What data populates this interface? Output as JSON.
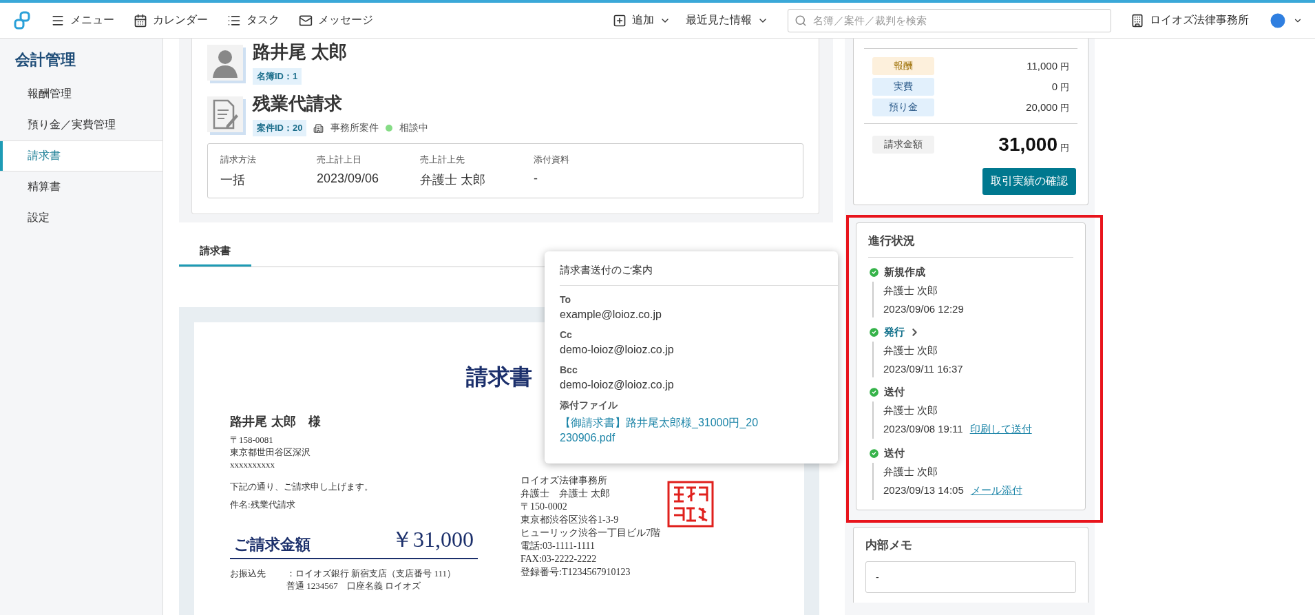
{
  "topbar": {
    "nav": [
      {
        "kind": "menu",
        "label": "メニュー"
      },
      {
        "kind": "calendar",
        "label": "カレンダー"
      },
      {
        "kind": "task",
        "label": "タスク"
      },
      {
        "kind": "message",
        "label": "メッセージ"
      }
    ],
    "add": "追加",
    "recent": "最近見た情報",
    "search": {
      "placeholder": "名簿／案件／裁判を検索"
    },
    "office": "ロイオズ法律事務所"
  },
  "sidebar": {
    "title": "会計管理",
    "items": [
      {
        "label": "報酬管理",
        "selected": false
      },
      {
        "label": "預り金／実費管理",
        "selected": false
      },
      {
        "label": "請求書",
        "selected": true
      },
      {
        "label": "精算書",
        "selected": false
      },
      {
        "label": "設定",
        "selected": false
      }
    ]
  },
  "header": {
    "client_name": "路井尾 太郎",
    "client_id": "名簿ID：1",
    "case_title": "残業代請求",
    "case_id": "案件ID：20",
    "case_type": "事務所案件",
    "status": {
      "label": "相談中",
      "color": "#86dc86"
    },
    "fields": [
      {
        "label": "請求方法",
        "value": "一括"
      },
      {
        "label": "売上計上日",
        "value": "2023/09/06"
      },
      {
        "label": "売上計上先",
        "value": "弁護士 太郎"
      },
      {
        "label": "添付資料",
        "value": "-"
      }
    ]
  },
  "tabs": [
    {
      "label": "請求書",
      "selected": true
    }
  ],
  "invoice": {
    "title": "請求書",
    "recipient": "路井尾 太郎　様",
    "address": [
      "〒158-0081",
      "東京都世田谷区深沢",
      "xxxxxxxxxx"
    ],
    "intro": "下記の通り、ご請求申し上げます。",
    "subject": "件名:残業代請求",
    "amount_label": "ご請求金額",
    "amount": "￥31,000",
    "bank_label": "お振込先",
    "bank_lines": [
      "：ロイオズ銀行 新宿支店（支店番号 111）",
      "普通 1234567　口座名義 ロイオズ"
    ],
    "issuer": [
      "ロイオズ法律事務所",
      "弁護士　弁護士 太郎",
      "〒150-0002",
      "東京都渋谷区渋谷1-3-9",
      "ヒューリック渋谷一丁目ビル7階",
      "電話:03-1111-1111",
      "FAX:03-2222-2222",
      "登録番号:T1234567910123"
    ]
  },
  "email_popup": {
    "title": "請求書送付のご案内",
    "fields": [
      {
        "label": "To",
        "value": "example@loioz.co.jp"
      },
      {
        "label": "Cc",
        "value": "demo-loioz@loioz.co.jp"
      },
      {
        "label": "Bcc",
        "value": "demo-loioz@loioz.co.jp"
      }
    ],
    "attachment": {
      "label": "添付ファイル",
      "file": "【御請求書】路井尾太郎様_31000円_20230906.pdf"
    }
  },
  "summary": {
    "rows": [
      {
        "kind": "fee",
        "label": "報酬",
        "amount": "11,000",
        "unit": "円"
      },
      {
        "kind": "expense",
        "label": "実費",
        "amount": "0",
        "unit": "円"
      },
      {
        "kind": "deposit",
        "label": "預り金",
        "amount": "20,000",
        "unit": "円"
      }
    ],
    "total": {
      "label": "請求金額",
      "amount": "31,000",
      "unit": "円"
    },
    "button": "取引実績の確認"
  },
  "progress": {
    "title": "進行状況",
    "highlighted": true,
    "steps": [
      {
        "kind": "plain",
        "title": "新規作成",
        "person": "弁護士 次郎",
        "time": "2023/09/06 12:29"
      },
      {
        "kind": "link",
        "title": "発行",
        "person": "弁護士 次郎",
        "time": "2023/09/11 16:37"
      },
      {
        "kind": "plain",
        "title": "送付",
        "person": "弁護士 次郎",
        "time": "2023/09/08 19:11",
        "action": "印刷して送付"
      },
      {
        "kind": "plain",
        "title": "送付",
        "person": "弁護士 次郎",
        "time": "2023/09/13 14:05",
        "action": "メール添付"
      }
    ]
  },
  "memo": {
    "title": "内部メモ",
    "value": "-"
  }
}
